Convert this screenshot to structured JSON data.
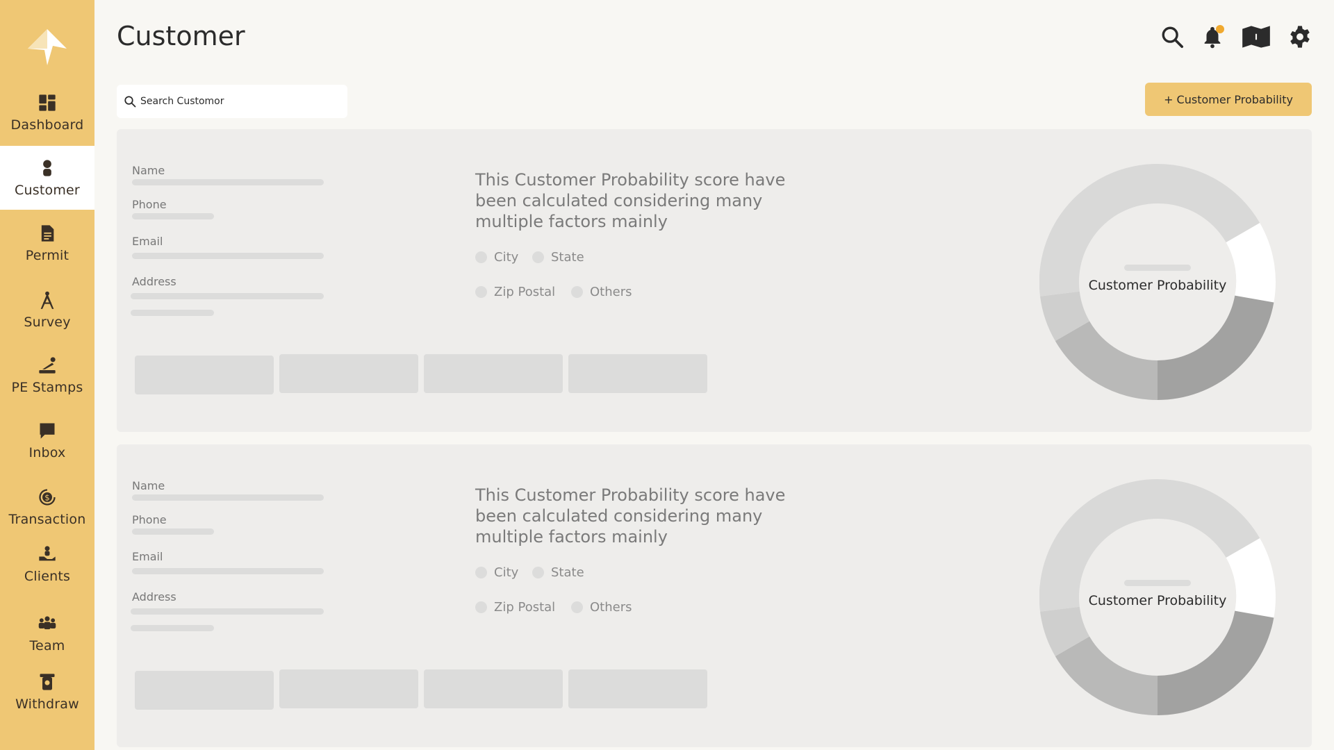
{
  "sidebar": {
    "items": [
      {
        "label": "Dashboard",
        "icon": "dashboard-icon"
      },
      {
        "label": "Customer",
        "icon": "person-icon",
        "active": true
      },
      {
        "label": "Permit",
        "icon": "document-icon"
      },
      {
        "label": "Survey",
        "icon": "compass-icon"
      },
      {
        "label": "PE Stamps",
        "icon": "stamp-icon"
      },
      {
        "label": "Inbox",
        "icon": "chat-icon"
      },
      {
        "label": "Transaction",
        "icon": "dollar-cycle-icon"
      },
      {
        "label": "Clients",
        "icon": "client-hand-icon"
      },
      {
        "label": "Team",
        "icon": "team-icon"
      },
      {
        "label": "Withdraw",
        "icon": "withdraw-icon"
      }
    ]
  },
  "header": {
    "title": "Customer",
    "icons": [
      "search-icon",
      "bell-icon",
      "map-icon",
      "gear-icon"
    ]
  },
  "search": {
    "placeholder": "Search Customor"
  },
  "add_button": {
    "label": "+ Customer  Probability"
  },
  "colors": {
    "accent": "#efc774",
    "notification": "#f0a92f",
    "card": "#eeedeb",
    "skeleton": "#dcdcdb"
  },
  "cards": [
    {
      "fields": [
        "Name",
        "Phone",
        "Email",
        "Address"
      ],
      "description": "This Customer Probability score have been calculated considering many multiple factors mainly",
      "factors": [
        "City",
        "State",
        "Zip Postal",
        "Others"
      ],
      "chart_title": "Customer Probability"
    },
    {
      "fields": [
        "Name",
        "Phone",
        "Email",
        "Address"
      ],
      "description": "This Customer Probability score have been calculated considering many multiple factors mainly",
      "factors": [
        "City",
        "State",
        "Zip Postal",
        "Others"
      ],
      "chart_title": "Customer Probability"
    }
  ]
}
